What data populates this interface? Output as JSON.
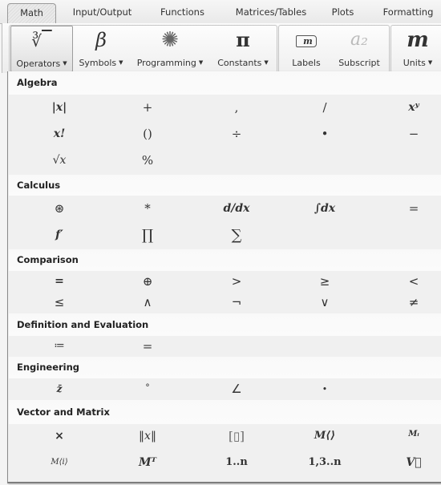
{
  "tabs": [
    {
      "label": "Math",
      "active": true
    },
    {
      "label": "Input/Output"
    },
    {
      "label": "Functions"
    },
    {
      "label": "Matrices/Tables"
    },
    {
      "label": "Plots"
    },
    {
      "label": "Formatting"
    }
  ],
  "ribbon": {
    "operators": {
      "icon": "cube-root-icon",
      "glyph": "∛‾",
      "label": "Operators",
      "caret": "▼"
    },
    "symbols": {
      "icon": "beta-icon",
      "glyph": "β",
      "label": "Symbols",
      "caret": "▼"
    },
    "programming": {
      "icon": "asterisk-burst-icon",
      "glyph": "✺",
      "label": "Programming",
      "caret": "▼"
    },
    "constants": {
      "icon": "pi-icon",
      "glyph": "π",
      "label": "Constants",
      "caret": "▼"
    },
    "labels": {
      "icon": "label-tag-icon",
      "glyph": "m",
      "label": "Labels"
    },
    "subscript": {
      "icon": "subscript-icon",
      "glyph": "a₂",
      "label": "Subscript"
    },
    "units": {
      "icon": "units-m-icon",
      "glyph": "m",
      "label": "Units",
      "caret": "▼"
    }
  },
  "sections": [
    {
      "title": "Algebra",
      "rows": [
        [
          "|x|",
          "+",
          ",",
          "/",
          "xʸ"
        ],
        [
          "x!",
          "()",
          "÷",
          "•",
          "−"
        ],
        [
          "√x",
          "%"
        ]
      ]
    },
    {
      "title": "Calculus",
      "rows": [
        [
          "⊛",
          "*",
          "d/dx",
          "∫dx",
          "="
        ],
        [
          "f′",
          "∏",
          "∑"
        ]
      ]
    },
    {
      "title": "Comparison",
      "rows": [
        [
          "=",
          "⊕",
          ">",
          "≥",
          "<"
        ],
        [
          "≤",
          "∧",
          "¬",
          "∨",
          "≠"
        ]
      ]
    },
    {
      "title": "Definition and Evaluation",
      "rows": [
        [
          "≔",
          "="
        ]
      ]
    },
    {
      "title": "Engineering",
      "rows": [
        [
          "z̄",
          "°",
          "∠",
          "•"
        ]
      ]
    },
    {
      "title": "Vector and Matrix",
      "rows": [
        [
          "×",
          "‖x‖",
          "[▯]",
          "M⟨⟩",
          "Mᵢ"
        ],
        [
          "M⟨i⟩",
          "Mᵀ",
          "1..n",
          "1,3..n",
          "V⃗"
        ]
      ]
    }
  ]
}
